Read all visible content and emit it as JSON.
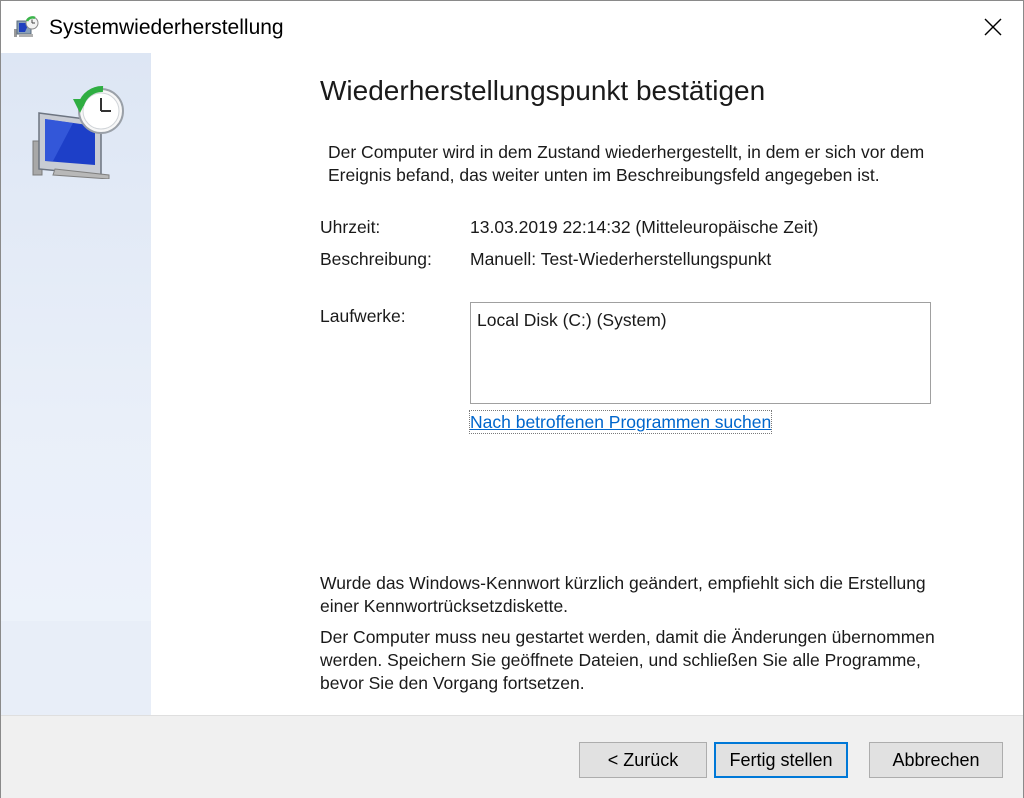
{
  "window": {
    "title": "Systemwiederherstellung"
  },
  "content": {
    "heading": "Wiederherstellungspunkt bestätigen",
    "intro": "Der Computer wird in dem Zustand wiederhergestellt, in dem er sich vor dem Ereignis befand, das weiter unten im Beschreibungsfeld angegeben ist.",
    "time_label": "Uhrzeit:",
    "time_value": "13.03.2019 22:14:32 (Mitteleuropäische Zeit)",
    "description_label": "Beschreibung:",
    "description_value": "Manuell: Test-Wiederherstellungspunkt",
    "drives_label": "Laufwerke:",
    "drives": [
      "Local Disk (C:) (System)"
    ],
    "scan_link": "Nach betroffenen Programmen suchen",
    "note_password": "Wurde das Windows-Kennwort kürzlich geändert, empfiehlt sich die Erstellung einer Kennwortrücksetzdiskette.",
    "note_restart": "Der Computer muss neu gestartet werden, damit die Änderungen übernommen werden. Speichern Sie geöffnete Dateien, und schließen Sie alle Programme, bevor Sie den Vorgang fortsetzen."
  },
  "buttons": {
    "back": "< Zurück",
    "finish": "Fertig stellen",
    "cancel": "Abbrechen"
  },
  "icons": {
    "title": "system-restore-icon",
    "close": "close-icon",
    "sidebar": "system-restore-large-icon"
  },
  "colors": {
    "link": "#0066cc",
    "default_button_border": "#0078d7",
    "sidebar": "#dde6f4"
  }
}
